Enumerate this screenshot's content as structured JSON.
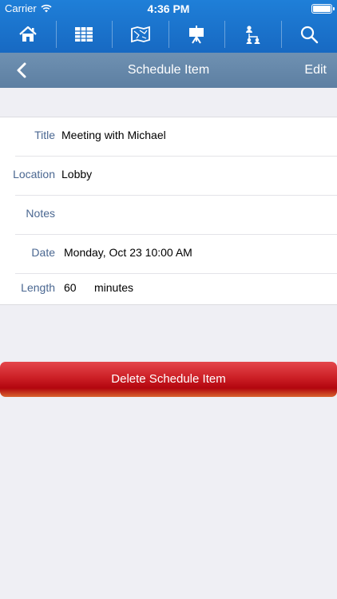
{
  "status": {
    "carrier": "Carrier",
    "time": "4:36 PM"
  },
  "toolbar": {
    "items": [
      {
        "icon": "home-icon"
      },
      {
        "icon": "table-grid-icon"
      },
      {
        "icon": "map-icon"
      },
      {
        "icon": "presentation-icon"
      },
      {
        "icon": "org-chart-icon"
      },
      {
        "icon": "search-icon"
      }
    ]
  },
  "nav": {
    "title": "Schedule Item",
    "edit_label": "Edit"
  },
  "form": {
    "title_label": "Title",
    "title_value": "Meeting with Michael",
    "location_label": "Location",
    "location_value": "Lobby",
    "notes_label": "Notes",
    "notes_value": "",
    "date_label": "Date",
    "date_value": "Monday, Oct 23 10:00 AM",
    "length_label": "Length",
    "length_value": "60",
    "length_unit": "minutes"
  },
  "actions": {
    "delete_label": "Delete Schedule Item"
  },
  "colors": {
    "toolbar_blue": "#1a73cc",
    "navbar": "#6688ab",
    "label_blue": "#4a6791",
    "delete_red": "#c4141b",
    "background": "#efeff4"
  }
}
